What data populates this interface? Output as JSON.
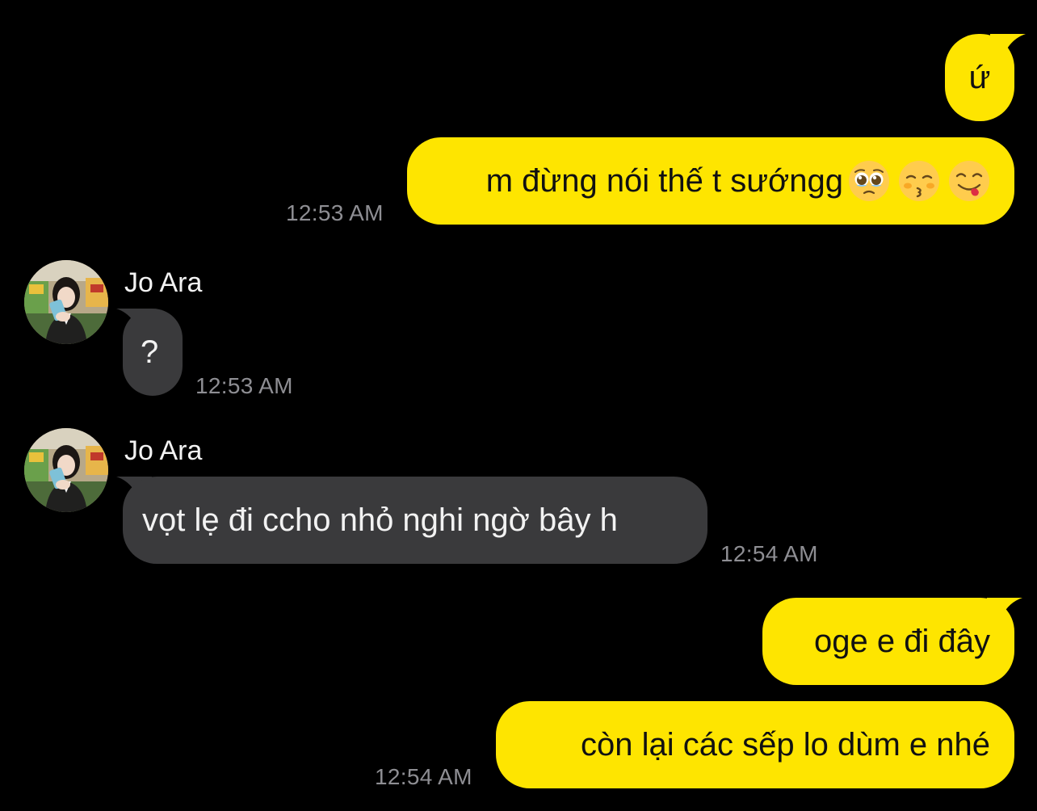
{
  "colors": {
    "background": "#000000",
    "outgoing_bubble": "#fee500",
    "incoming_bubble": "#3a3a3c",
    "timestamp": "#8e8e93"
  },
  "messages": [
    {
      "direction": "outgoing",
      "text": "ứ",
      "time": ""
    },
    {
      "direction": "outgoing",
      "text": "m đừng nói thế t sướngg",
      "emojis": [
        "pleading-face-icon",
        "kissing-face-icon",
        "yum-face-icon"
      ],
      "time": "12:53 AM"
    },
    {
      "direction": "incoming",
      "sender": "Jo Ara",
      "text": "?",
      "time": "12:53 AM"
    },
    {
      "direction": "incoming",
      "sender": "Jo Ara",
      "text": "vọt lẹ đi ccho nhỏ nghi ngờ bây h",
      "time": "12:54 AM"
    },
    {
      "direction": "outgoing",
      "text": "oge e đi đây",
      "time": ""
    },
    {
      "direction": "outgoing",
      "text": "còn lại các sếp lo dùm e nhé",
      "time": "12:54 AM"
    }
  ]
}
